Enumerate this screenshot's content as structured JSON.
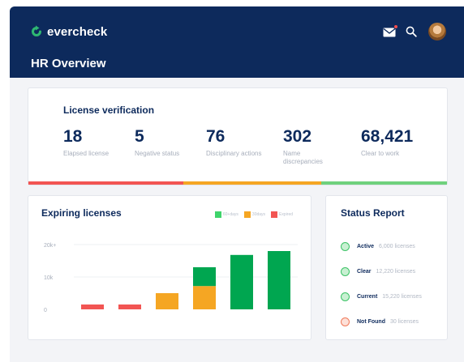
{
  "app": {
    "brand": "evercheck",
    "page_title": "HR Overview",
    "brand_color": "#0d2a5c",
    "accent_color": "#2eb872",
    "icons": [
      "logo-icon",
      "mail-icon",
      "search-icon",
      "avatar"
    ]
  },
  "license_verification": {
    "title": "License verification",
    "stats": [
      {
        "value": "18",
        "label": "Elapsed license"
      },
      {
        "value": "5",
        "label": "Negative status"
      },
      {
        "value": "76",
        "label": "Disciplinary actions"
      },
      {
        "value": "302",
        "label": "Name discrepancies"
      },
      {
        "value": "68,421",
        "label": "Clear to work"
      }
    ],
    "progress_segments": [
      {
        "fraction": 0.37,
        "color": "#f25553"
      },
      {
        "fraction": 0.33,
        "color": "#f5a623"
      },
      {
        "fraction": 0.3,
        "color": "#6fd17d"
      }
    ]
  },
  "expiring": {
    "title": "Expiring licenses",
    "legend": [
      {
        "label": "60+days",
        "color": "#3fd46b"
      },
      {
        "label": "30days",
        "color": "#f5a623"
      },
      {
        "label": "Expired",
        "color": "#f25553"
      }
    ]
  },
  "chart_data": {
    "type": "bar",
    "stacked": true,
    "title": "Expiring licenses",
    "y_tick_labels": [
      "0",
      "10k",
      "20k+"
    ],
    "y_ticks": [
      0,
      10000,
      20000
    ],
    "ylim": [
      0,
      22000
    ],
    "grid": true,
    "legend_position": "top-right",
    "categories": [
      "",
      "",
      "",
      "",
      "",
      ""
    ],
    "series": [
      {
        "name": "Expired",
        "color": "#f25553",
        "values": [
          1500,
          1500,
          0,
          0,
          0,
          0
        ]
      },
      {
        "name": "30days",
        "color": "#f5a623",
        "values": [
          0,
          0,
          5000,
          7200,
          0,
          0
        ]
      },
      {
        "name": "60+days",
        "color": "#00a650",
        "values": [
          0,
          0,
          0,
          5800,
          16800,
          18000
        ]
      }
    ]
  },
  "status_report": {
    "title": "Status Report",
    "items": [
      {
        "name": "Active",
        "count": "6,000 licenses",
        "fill": "#c8f0d2",
        "stroke": "#3cc266"
      },
      {
        "name": "Clear",
        "count": "12,220 licenses",
        "fill": "#c8f0d2",
        "stroke": "#3cc266"
      },
      {
        "name": "Current",
        "count": "15,220 licenses",
        "fill": "#c8f0d2",
        "stroke": "#3cc266"
      },
      {
        "name": "Not Found",
        "count": "30 licenses",
        "fill": "#fde0d8",
        "stroke": "#f07a5a"
      }
    ]
  }
}
